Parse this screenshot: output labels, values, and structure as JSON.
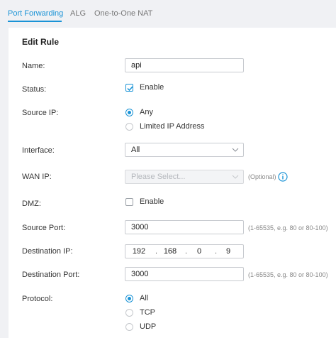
{
  "tabs": [
    {
      "label": "Port Forwarding",
      "active": true
    },
    {
      "label": "ALG",
      "active": false
    },
    {
      "label": "One-to-One NAT",
      "active": false
    }
  ],
  "accent_color": "#1a93d6",
  "panel": {
    "title": "Edit Rule"
  },
  "form": {
    "name": {
      "label": "Name:",
      "value": "api"
    },
    "status": {
      "label": "Status:",
      "checkbox_label": "Enable",
      "checked": true
    },
    "source_ip": {
      "label": "Source IP:",
      "options": [
        "Any",
        "Limited IP Address"
      ],
      "selected": "Any"
    },
    "interface": {
      "label": "Interface:",
      "value": "All"
    },
    "wan_ip": {
      "label": "WAN IP:",
      "placeholder": "Please Select...",
      "hint": "(Optional)",
      "disabled": true
    },
    "dmz": {
      "label": "DMZ:",
      "checkbox_label": "Enable",
      "checked": false
    },
    "source_port": {
      "label": "Source Port:",
      "value": "3000",
      "hint": "(1-65535, e.g. 80 or 80-100)"
    },
    "destination_ip": {
      "label": "Destination IP:",
      "octets": [
        "192",
        "168",
        "0",
        "9"
      ],
      "separator": "."
    },
    "destination_port": {
      "label": "Destination Port:",
      "value": "3000",
      "hint": "(1-65535, e.g. 80 or 80-100)"
    },
    "protocol": {
      "label": "Protocol:",
      "options": [
        "All",
        "TCP",
        "UDP"
      ],
      "selected": "All"
    }
  },
  "icons": {
    "info": "info-icon",
    "dropdown": "chevron-down-icon",
    "check": "checkmark-icon"
  }
}
